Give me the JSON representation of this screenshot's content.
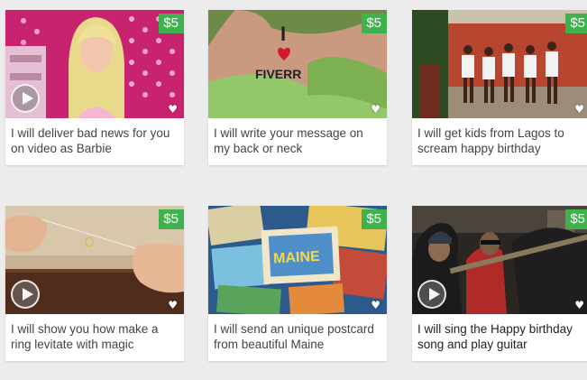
{
  "gigs": [
    {
      "title": "I will deliver bad news for you on video as Barbie",
      "price": "$5",
      "has_video": true
    },
    {
      "title": "I will write your message on my back or neck",
      "price": "$5",
      "has_video": false
    },
    {
      "title": "I will get kids from Lagos to scream happy birthday",
      "price": "$5",
      "has_video": false
    },
    {
      "title": "I will show you how make a ring levitate with magic",
      "price": "$5",
      "has_video": true
    },
    {
      "title": "I will send an unique postcard from beautiful Maine",
      "price": "$5",
      "has_video": false
    },
    {
      "title": "I will sing the Happy birthday song and play guitar",
      "price": "$5",
      "has_video": true
    }
  ],
  "thumb_text": {
    "back_line1": "I",
    "back_line2": "FIVERR",
    "postcard": "MAINE"
  },
  "icons": {
    "play": "play-icon",
    "heart": "heart-icon"
  },
  "colors": {
    "price_badge": "#3fb24d",
    "background": "#ececec"
  }
}
